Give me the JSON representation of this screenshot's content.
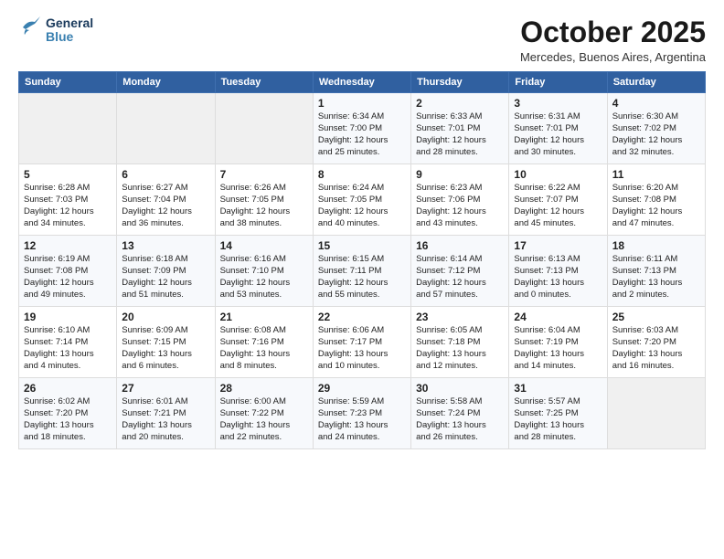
{
  "logo": {
    "line1": "General",
    "line2": "Blue"
  },
  "title": "October 2025",
  "subtitle": "Mercedes, Buenos Aires, Argentina",
  "weekdays": [
    "Sunday",
    "Monday",
    "Tuesday",
    "Wednesday",
    "Thursday",
    "Friday",
    "Saturday"
  ],
  "weeks": [
    [
      {
        "day": "",
        "detail": ""
      },
      {
        "day": "",
        "detail": ""
      },
      {
        "day": "",
        "detail": ""
      },
      {
        "day": "1",
        "detail": "Sunrise: 6:34 AM\nSunset: 7:00 PM\nDaylight: 12 hours\nand 25 minutes."
      },
      {
        "day": "2",
        "detail": "Sunrise: 6:33 AM\nSunset: 7:01 PM\nDaylight: 12 hours\nand 28 minutes."
      },
      {
        "day": "3",
        "detail": "Sunrise: 6:31 AM\nSunset: 7:01 PM\nDaylight: 12 hours\nand 30 minutes."
      },
      {
        "day": "4",
        "detail": "Sunrise: 6:30 AM\nSunset: 7:02 PM\nDaylight: 12 hours\nand 32 minutes."
      }
    ],
    [
      {
        "day": "5",
        "detail": "Sunrise: 6:28 AM\nSunset: 7:03 PM\nDaylight: 12 hours\nand 34 minutes."
      },
      {
        "day": "6",
        "detail": "Sunrise: 6:27 AM\nSunset: 7:04 PM\nDaylight: 12 hours\nand 36 minutes."
      },
      {
        "day": "7",
        "detail": "Sunrise: 6:26 AM\nSunset: 7:05 PM\nDaylight: 12 hours\nand 38 minutes."
      },
      {
        "day": "8",
        "detail": "Sunrise: 6:24 AM\nSunset: 7:05 PM\nDaylight: 12 hours\nand 40 minutes."
      },
      {
        "day": "9",
        "detail": "Sunrise: 6:23 AM\nSunset: 7:06 PM\nDaylight: 12 hours\nand 43 minutes."
      },
      {
        "day": "10",
        "detail": "Sunrise: 6:22 AM\nSunset: 7:07 PM\nDaylight: 12 hours\nand 45 minutes."
      },
      {
        "day": "11",
        "detail": "Sunrise: 6:20 AM\nSunset: 7:08 PM\nDaylight: 12 hours\nand 47 minutes."
      }
    ],
    [
      {
        "day": "12",
        "detail": "Sunrise: 6:19 AM\nSunset: 7:08 PM\nDaylight: 12 hours\nand 49 minutes."
      },
      {
        "day": "13",
        "detail": "Sunrise: 6:18 AM\nSunset: 7:09 PM\nDaylight: 12 hours\nand 51 minutes."
      },
      {
        "day": "14",
        "detail": "Sunrise: 6:16 AM\nSunset: 7:10 PM\nDaylight: 12 hours\nand 53 minutes."
      },
      {
        "day": "15",
        "detail": "Sunrise: 6:15 AM\nSunset: 7:11 PM\nDaylight: 12 hours\nand 55 minutes."
      },
      {
        "day": "16",
        "detail": "Sunrise: 6:14 AM\nSunset: 7:12 PM\nDaylight: 12 hours\nand 57 minutes."
      },
      {
        "day": "17",
        "detail": "Sunrise: 6:13 AM\nSunset: 7:13 PM\nDaylight: 13 hours\nand 0 minutes."
      },
      {
        "day": "18",
        "detail": "Sunrise: 6:11 AM\nSunset: 7:13 PM\nDaylight: 13 hours\nand 2 minutes."
      }
    ],
    [
      {
        "day": "19",
        "detail": "Sunrise: 6:10 AM\nSunset: 7:14 PM\nDaylight: 13 hours\nand 4 minutes."
      },
      {
        "day": "20",
        "detail": "Sunrise: 6:09 AM\nSunset: 7:15 PM\nDaylight: 13 hours\nand 6 minutes."
      },
      {
        "day": "21",
        "detail": "Sunrise: 6:08 AM\nSunset: 7:16 PM\nDaylight: 13 hours\nand 8 minutes."
      },
      {
        "day": "22",
        "detail": "Sunrise: 6:06 AM\nSunset: 7:17 PM\nDaylight: 13 hours\nand 10 minutes."
      },
      {
        "day": "23",
        "detail": "Sunrise: 6:05 AM\nSunset: 7:18 PM\nDaylight: 13 hours\nand 12 minutes."
      },
      {
        "day": "24",
        "detail": "Sunrise: 6:04 AM\nSunset: 7:19 PM\nDaylight: 13 hours\nand 14 minutes."
      },
      {
        "day": "25",
        "detail": "Sunrise: 6:03 AM\nSunset: 7:20 PM\nDaylight: 13 hours\nand 16 minutes."
      }
    ],
    [
      {
        "day": "26",
        "detail": "Sunrise: 6:02 AM\nSunset: 7:20 PM\nDaylight: 13 hours\nand 18 minutes."
      },
      {
        "day": "27",
        "detail": "Sunrise: 6:01 AM\nSunset: 7:21 PM\nDaylight: 13 hours\nand 20 minutes."
      },
      {
        "day": "28",
        "detail": "Sunrise: 6:00 AM\nSunset: 7:22 PM\nDaylight: 13 hours\nand 22 minutes."
      },
      {
        "day": "29",
        "detail": "Sunrise: 5:59 AM\nSunset: 7:23 PM\nDaylight: 13 hours\nand 24 minutes."
      },
      {
        "day": "30",
        "detail": "Sunrise: 5:58 AM\nSunset: 7:24 PM\nDaylight: 13 hours\nand 26 minutes."
      },
      {
        "day": "31",
        "detail": "Sunrise: 5:57 AM\nSunset: 7:25 PM\nDaylight: 13 hours\nand 28 minutes."
      },
      {
        "day": "",
        "detail": ""
      }
    ]
  ]
}
